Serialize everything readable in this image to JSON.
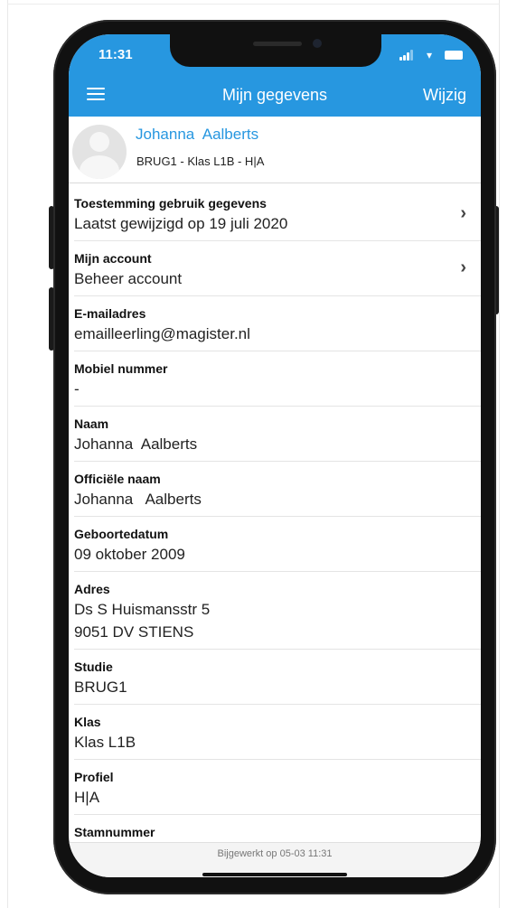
{
  "status_bar": {
    "time": "11:31"
  },
  "header": {
    "title": "Mijn gegevens",
    "edit_label": "Wijzig",
    "menu_icon": "hamburger-menu-icon"
  },
  "profile": {
    "name": "Johanna  Aalberts",
    "subtitle": "BRUG1 - Klas L1B - H|A"
  },
  "fields": [
    {
      "label": "Toestemming gebruik gegevens",
      "value": "Laatst gewijzigd op 19 juli 2020",
      "has_chevron": true
    },
    {
      "label": "Mijn account",
      "value": "Beheer account",
      "has_chevron": true
    },
    {
      "label": "E-mailadres",
      "value": "emailleerling@magister.nl"
    },
    {
      "label": "Mobiel nummer",
      "value": "-"
    },
    {
      "label": "Naam",
      "value": "Johanna  Aalberts"
    },
    {
      "label": "Officiële naam",
      "value": "Johanna   Aalberts"
    },
    {
      "label": "Geboortedatum",
      "value": "09 oktober 2009"
    },
    {
      "label": "Adres",
      "value": "Ds S Huismansstr 5",
      "value2": "9051 DV STIENS"
    },
    {
      "label": "Studie",
      "value": "BRUG1"
    },
    {
      "label": "Klas",
      "value": "Klas L1B"
    },
    {
      "label": "Profiel",
      "value": "H|A"
    },
    {
      "label": "Stamnummer"
    }
  ],
  "footer": {
    "updated_text": "Bijgewerkt op 05-03 11:31"
  },
  "colors": {
    "accent": "#2797e0",
    "header_text": "#ffffff",
    "name_text": "#2797e0"
  }
}
